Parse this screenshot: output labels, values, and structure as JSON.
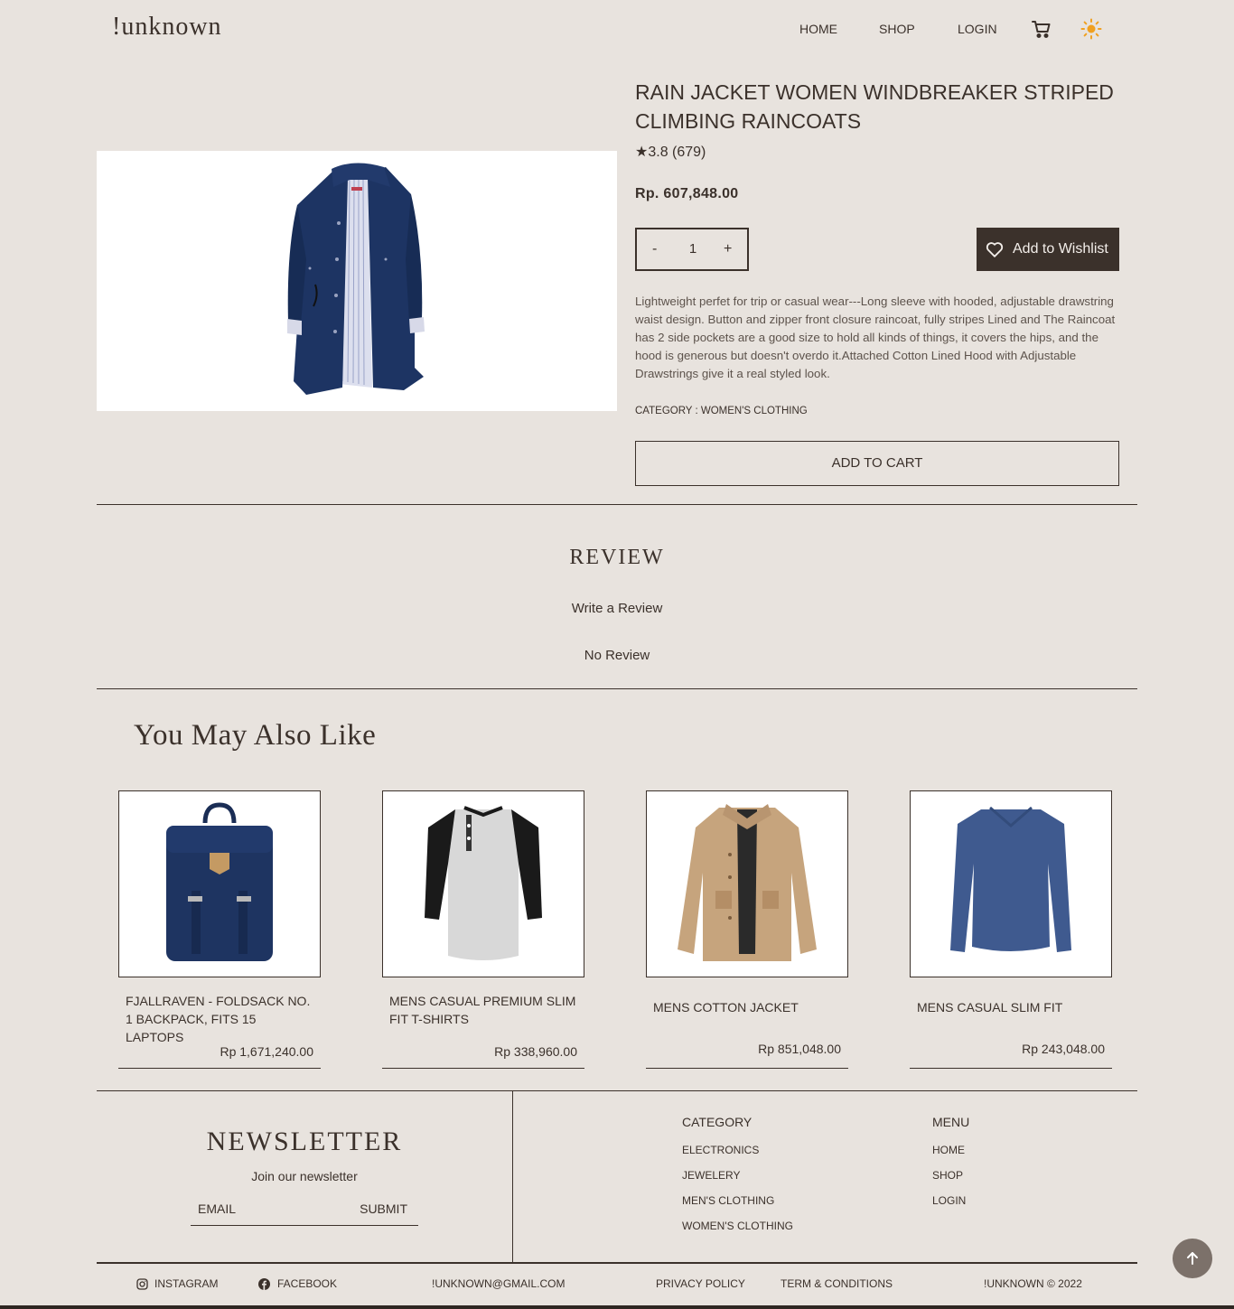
{
  "nav": {
    "logo": "!unknown",
    "links": [
      "HOME",
      "SHOP",
      "LOGIN"
    ],
    "cart_icon": "cart-icon",
    "theme_icon": "sun-icon"
  },
  "product": {
    "title": "RAIN JACKET WOMEN WINDBREAKER STRIPED CLIMBING RAINCOATS",
    "rating": "★3.8 (679)",
    "price": "Rp. 607,848.00",
    "quantity": {
      "minus": "-",
      "value": "1",
      "plus": "+"
    },
    "wishlist_label": "Add to Wishlist",
    "description": "Lightweight perfet for trip or casual wear---Long sleeve with hooded, adjustable drawstring waist design. Button and zipper front closure raincoat, fully stripes Lined and The Raincoat has 2 side pockets are a good size to hold all kinds of things, it covers the hips, and the hood is generous but doesn't overdo it.Attached Cotton Lined Hood with Adjustable Drawstrings give it a real styled look.",
    "category": "CATEGORY : WOMEN'S CLOTHING",
    "add_to_cart": "ADD TO CART"
  },
  "review": {
    "title": "REVIEW",
    "write_label": "Write a Review",
    "empty_label": "No Review"
  },
  "related": {
    "title": "You May Also Like",
    "items": [
      {
        "name": "FJALLRAVEN - FOLDSACK NO. 1 BACKPACK, FITS 15 LAPTOPS",
        "price": "Rp 1,671,240.00"
      },
      {
        "name": "MENS CASUAL PREMIUM SLIM FIT T-SHIRTS",
        "price": "Rp 338,960.00"
      },
      {
        "name": "MENS COTTON JACKET",
        "price": "Rp 851,048.00"
      },
      {
        "name": "MENS CASUAL SLIM FIT",
        "price": "Rp 243,048.00"
      }
    ]
  },
  "footer": {
    "newsletter_title": "NEWSLETTER",
    "newsletter_sub": "Join our newsletter",
    "email_placeholder": "EMAIL",
    "submit_label": "SUBMIT",
    "category_head": "CATEGORY",
    "categories": [
      "ELECTRONICS",
      "JEWELERY",
      "MEN'S CLOTHING",
      "WOMEN'S CLOTHING"
    ],
    "menu_head": "MENU",
    "menu": [
      "HOME",
      "SHOP",
      "LOGIN"
    ],
    "bottom": {
      "instagram": "INSTAGRAM",
      "facebook": "FACEBOOK",
      "email": "!UNKNOWN@GMAIL.COM",
      "privacy": "PRIVACY POLICY",
      "terms": "TERM & CONDITIONS",
      "copyright": "!UNKNOWN © 2022"
    }
  },
  "colors": {
    "background": "#e8e3de",
    "text": "#3b312b",
    "button_dark": "#3b312b",
    "sun": "#f0a020"
  }
}
